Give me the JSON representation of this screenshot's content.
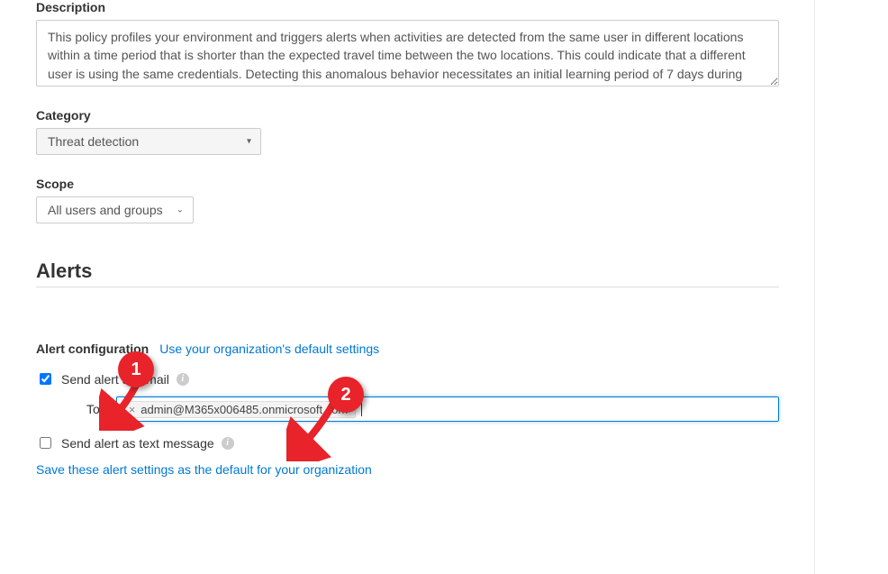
{
  "description": {
    "label": "Description",
    "text": "This policy profiles your environment and triggers alerts when activities are detected from the same user in different locations within a time period that is shorter than the expected travel time between the two locations. This could indicate that a different user is using the same credentials. Detecting this anomalous behavior necessitates an initial learning period of 7 days during which it learns a new user's activity pattern."
  },
  "category": {
    "label": "Category",
    "selected": "Threat detection"
  },
  "scope": {
    "label": "Scope",
    "selected": "All users and groups"
  },
  "alerts": {
    "heading": "Alerts",
    "config_label": "Alert configuration",
    "defaults_link": "Use your organization's default settings",
    "send_email": {
      "label": "Send alert as email",
      "checked": true,
      "to_label": "To:",
      "recipients": [
        "admin@M365x006485.onmicrosoft.com"
      ]
    },
    "send_text": {
      "label": "Send alert as text message",
      "checked": false
    },
    "save_defaults_link": "Save these alert settings as the default for your organization"
  },
  "annotations": {
    "badge1": "1",
    "badge2": "2"
  }
}
